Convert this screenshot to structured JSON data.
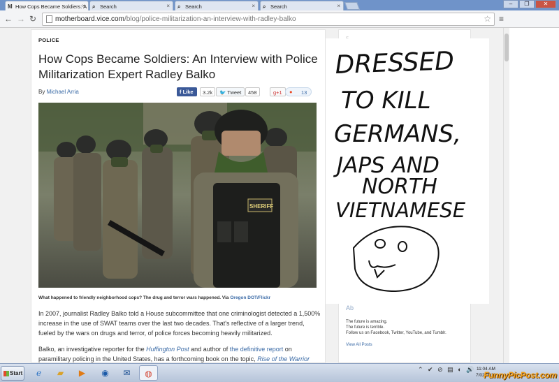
{
  "browser": {
    "tabs": [
      {
        "label": "How Cops Became Soldiers: A",
        "icon": "M"
      },
      {
        "label": "Search",
        "icon": "search-icon"
      },
      {
        "label": "Search",
        "icon": "search-icon"
      },
      {
        "label": "Search",
        "icon": "search-icon"
      }
    ],
    "url_domain": "motherboard.vice.com",
    "url_path": "/blog/police-militarization-an-interview-with-radley-balko",
    "window_buttons": [
      "–",
      "❐",
      "✕"
    ]
  },
  "article": {
    "section": "POLICE",
    "headline": "How Cops Became Soldiers: An Interview with Police Militarization Expert Radley Balko",
    "byline_prefix": "By",
    "author": "Michael Arria",
    "share": {
      "like_label": "Like",
      "like_count": "3.2k",
      "tweet_label": "Tweet",
      "tweet_count": "458",
      "gplus_label": "g+1",
      "stumble_count": "13"
    },
    "photo_patch_text": "SHERIFF",
    "caption_text": "What happened to friendly neighborhood cops? The drug and terror wars happened. Via",
    "caption_link": "Oregon DOT/Flickr",
    "para1": "In 2007, journalist Radley Balko told a House subcommittee that one criminologist detected a 1,500% increase in the use of SWAT teams over the last two decades. That's reflective of a larger trend, fueled by the wars on drugs and terror, of police forces becoming heavily militarized.",
    "para2_a": "Balko, an investigative reporter for the",
    "para2_em1": "Huffington Post",
    "para2_b": "and author of",
    "para2_link": "the definitive report",
    "para2_c": "on paramilitary policing in the United States, has a forthcoming book on the topic,",
    "para2_em2": "Rise of the Warrior"
  },
  "sidebar": {
    "top_card_text": "E",
    "card_heading": "Ab",
    "lines": [
      "The future is amazing.",
      "The future is terrible.",
      "Follow us on Facebook, Twitter, YouTube, and Tumblr."
    ],
    "view_posts": "View All Posts"
  },
  "handwriting": {
    "lines": [
      "DRESSED",
      "TO KILL",
      "GERMANS,",
      "JAPS AND",
      "NORTH",
      "VIETNAMESE"
    ]
  },
  "taskbar": {
    "start_label": "Start",
    "tray_icons": "⌃ ✔ ⊘ ▤ ◐ 🔊",
    "clock_time": "11:04 AM",
    "clock_date": "7/02/2013",
    "watermark": "FunnyPicPost.com"
  },
  "colors": {
    "link": "#3a6aa6",
    "facebook": "#3b5998",
    "watermark": "#f4a21c"
  }
}
